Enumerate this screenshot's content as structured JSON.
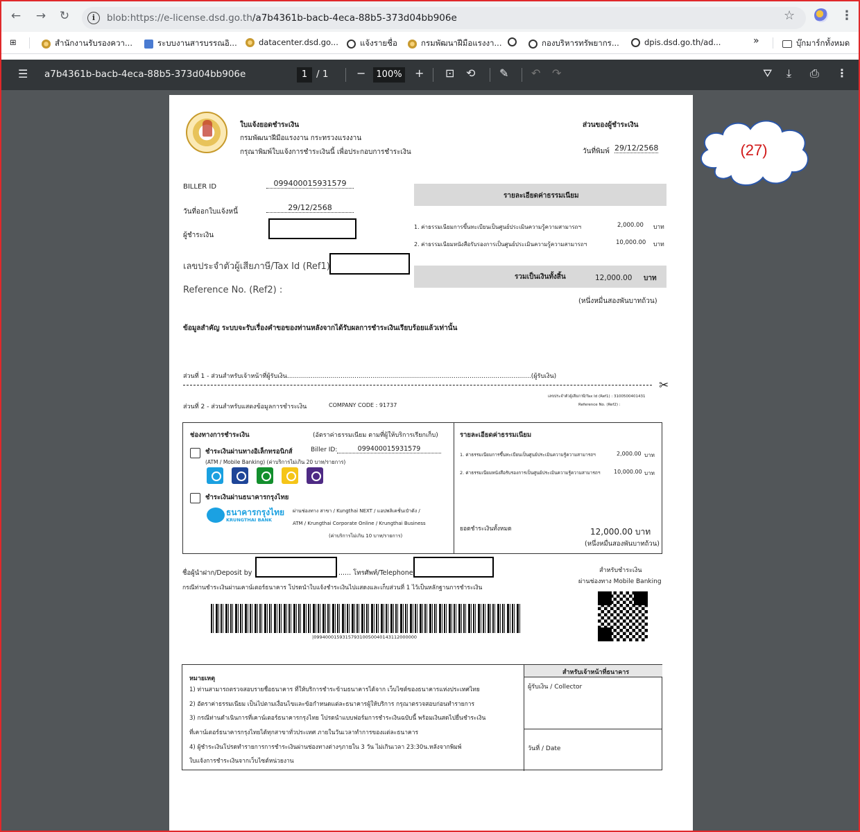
{
  "browser": {
    "url_host": "blob:https://e-license.dsd.go.th",
    "url_path": "/a7b4361b-bacb-4eca-88b5-373d04bb906e",
    "bookmarks": [
      "สำนักงานรับรองควา...",
      "ระบบงานสารบรรณอิ...",
      "datacenter.dsd.go...",
      "แจ้งรายชื่อ",
      "กรมพัฒนาฝีมือแรงงา...",
      "กองบริหารทรัพยากร...",
      "dpis.dsd.go.th/ad..."
    ],
    "bookmarks_more": "»",
    "all_bookmarks": "บุ๊กมาร์กทั้งหมด"
  },
  "pdf": {
    "filename": "a7b4361b-bacb-4eca-88b5-373d04bb906e",
    "page_current": "1",
    "page_total": "/ 1",
    "zoom": "100%"
  },
  "doc": {
    "title": "ใบแจ้งยอดชำระเงิน",
    "dept": "กรมพัฒนาฝีมือแรงงาน กระทรวงแรงงาน",
    "instruction": "กรุณาพิมพ์ใบแจ้งการชำระเงินนี้ เพื่อประกอบการชำระเงิน",
    "payer_part": "ส่วนของผู้ชำระเงิน",
    "print_date_label": "วันที่พิมพ์",
    "print_date": "29/12/2568",
    "biller_label": "BILLER ID",
    "biller_id": "099400015931579",
    "issue_label": "วันที่ออกใบแจ้งหนี้",
    "issue_date": "29/12/2568",
    "payer_label": "ผู้ชำระเงิน",
    "taxid_label": "เลขประจำตัวผู้เสียภาษี/Tax Id (Ref1) :",
    "ref2_label": "Reference No. (Ref2) :",
    "fee_header": "รายละเอียดค่าธรรมเนียม",
    "fees": [
      {
        "desc": "1. ค่าธรรมเนียมการขึ้นทะเบียนเป็นศูนย์ประเมินความรู้ความสามารถฯ",
        "amount": "2,000.00",
        "unit": "บาท"
      },
      {
        "desc": "2. ค่าธรรมเนียมหนังสือรับรองการเป็นศูนย์ประเมินความรู้ความสามารถฯ",
        "amount": "10,000.00",
        "unit": "บาท"
      }
    ],
    "total_label": "รวมเป็นเงินทั้งสิ้น",
    "total": "12,000.00",
    "total_unit": "บาท",
    "total_words": "(หนึ่งหมื่นสองพันบาทถ้วน)",
    "important": "ข้อมูลสำคัญ  ระบบจะรับเรื่องคำขอของท่านหลังจากได้รับผลการชำระเงินเรียบร้อยแล้วเท่านั้น",
    "part1": "ส่วนที่ 1 - ส่วนสำหรับเจ้าหน้าที่ผู้รับเงิน...........................................................................................................................(ผู้รับเงิน)",
    "scissors": "✂",
    "part2": "ส่วนที่ 2 - ส่วนสำหรับแสดงข้อมูลการชำระเงิน",
    "company_code": "COMPANY CODE : 91737",
    "part2_taxid": "เลขประจำตัวผู้เสียภาษี/Tax Id (Ref1) : 3100500401431",
    "part2_ref": "Reference No. (Ref2) :",
    "channel_header": "ช่องทางการชำระเงิน",
    "channel_note": "(อัตราค่าธรรมเนียม ตามที่ผู้ให้บริการเรียกเก็บ)",
    "ebank_label": "ชำระเงินผ่านทางอิเล็กทรอนิกส์",
    "ebank_biller": "Biller ID:",
    "ebank_biller_id": "099400015931579",
    "ebank_note": "(ATM / Mobile Banking) (ค่าบริการไม่เกิน 20 บาท/รายการ)",
    "ktb_label": "ชำระเงินผ่านธนาคารกรุงไทย",
    "ktb_logo_th": "ธนาคารกรุงไทย",
    "ktb_logo_en": "KRUNGTHAI BANK",
    "ktb_channels1": "ผ่านช่องทาง สาขา / Kungthai NEXT / แอปพลิเคชั่นเป๋าตัง /",
    "ktb_channels2": "ATM /  Krungthai Corporate Online / Krungthai Business",
    "ktb_fee": "(ค่าบริการไม่เกิน 10 บาท/รายการ)",
    "fee_header2": "รายละเอียดค่าธรรมเนียม",
    "total2_label": "ยอดชำระเงินทั้งหมด",
    "total2": "12,000.00 บาท",
    "total2_words": "(หนึ่งหมื่นสองพันบาทถ้วน)",
    "deposit_label": "ชื่อผู้นำฝาก/Deposit by",
    "phone_label": "...... โทรศัพท์/Telephone",
    "counter_note": "กรณีท่านชำระเงินผ่านเคาน์เตอร์ธนาคาร โปรดนำใบแจ้งชำระเงินไปแสดงและเก็บส่วนที่ 1 ไว้เป็นหลักฐานการชำระเงิน",
    "mobile_line1": "สำหรับชำระเงิน",
    "mobile_line2": "ผ่านช่องทาง Mobile Banking",
    "barcode_text": "|099400015931579310050040143112000000",
    "notes_title": "หมายเหตุ",
    "notes": [
      "1) ท่านสามารถตรวจสอบรายชื่อธนาคาร ที่ให้บริการชำระข้ามธนาคารได้จาก เว็บไซต์ของธนาคารแห่งประเทศไทย",
      "2) อัตราค่าธรรมเนียม เป็นไปตามเงื่อนไขและข้อกำหนดแต่ละธนาคารผู้ให้บริการ กรุณาตรวจสอบก่อนทำรายการ",
      "3) กรณีท่านดำเนินการที่เคาน์เตอร์ธนาคารกรุงไทย โปรดนำแบบฟอร์มการชำระเงินฉบับนี้ พร้อมเงินสดไปยื่นชำระเงิน",
      "ที่เคาน์เตอร์ธนาคารกรุงไทยได้ทุกสาขาทั่วประเทศ ภายในวันเวลาทำการของแต่ละธนาคาร",
      "4) ผู้ชำระเงินโปรดทำรายการการชำระเงินผ่านช่องทางต่างๆภายใน 3 วัน ไม่เกินเวลา 23:30น.หลังจากพิมพ์",
      "ใบแจ้งการชำระเงินจากเว็บไซต์หน่วยงาน"
    ],
    "bank_officer": "สำหรับเจ้าหน้าที่ธนาคาร",
    "collector": "ผู้รับเงิน / Collector",
    "date_label": "วันที่ / Date"
  },
  "annotation": {
    "label": "(27)",
    "color": "#d11818"
  }
}
